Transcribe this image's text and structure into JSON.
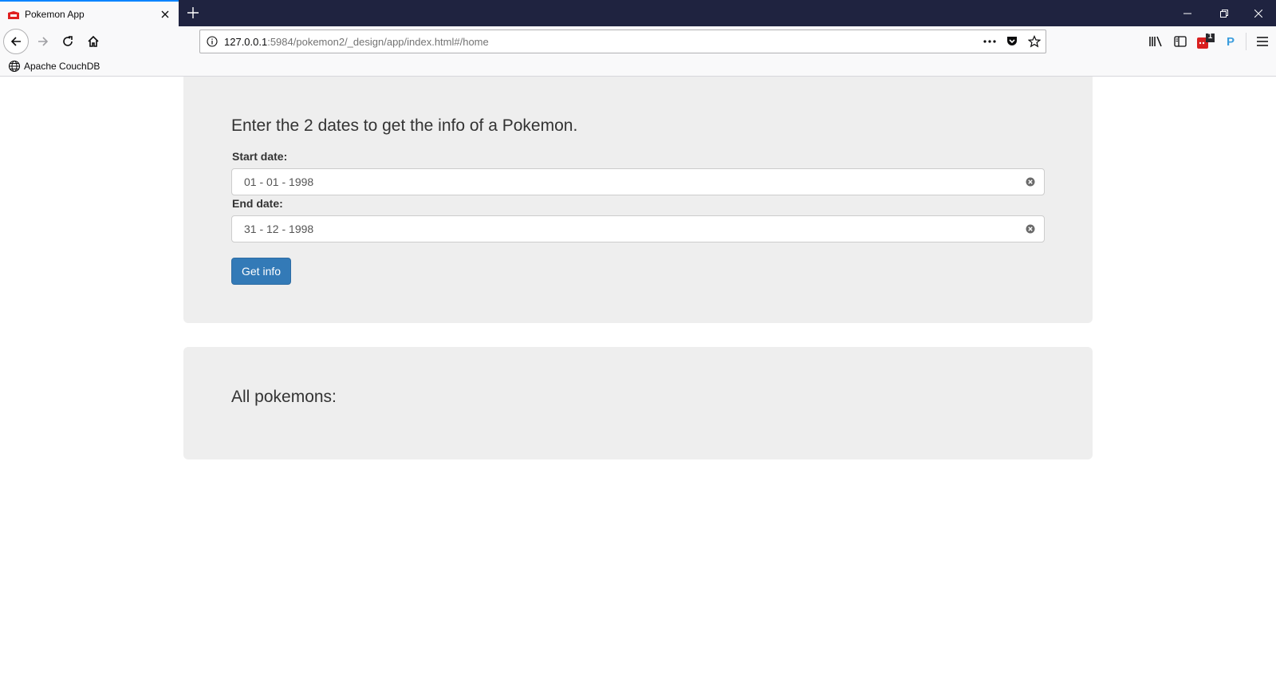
{
  "browser": {
    "tab_title": "Pokemon App",
    "url_host": "127.0.0.1",
    "url_path": ":5984/pokemon2/_design/app/index.html#/home",
    "bookmark_label": "Apache CouchDB",
    "extension_badge": "1",
    "extension_p_label": "P",
    "accent_color": "#0a84ff",
    "titlebar_color": "#1f2340"
  },
  "form": {
    "heading": "Enter the 2 dates to get the info of a Pokemon.",
    "start_label": "Start date:",
    "start_value": "01 - 01 - 1998",
    "end_label": "End date:",
    "end_value": "31 - 12 - 1998",
    "submit_label": "Get info",
    "button_color": "#337ab7"
  },
  "results": {
    "heading": "All pokemons:"
  }
}
